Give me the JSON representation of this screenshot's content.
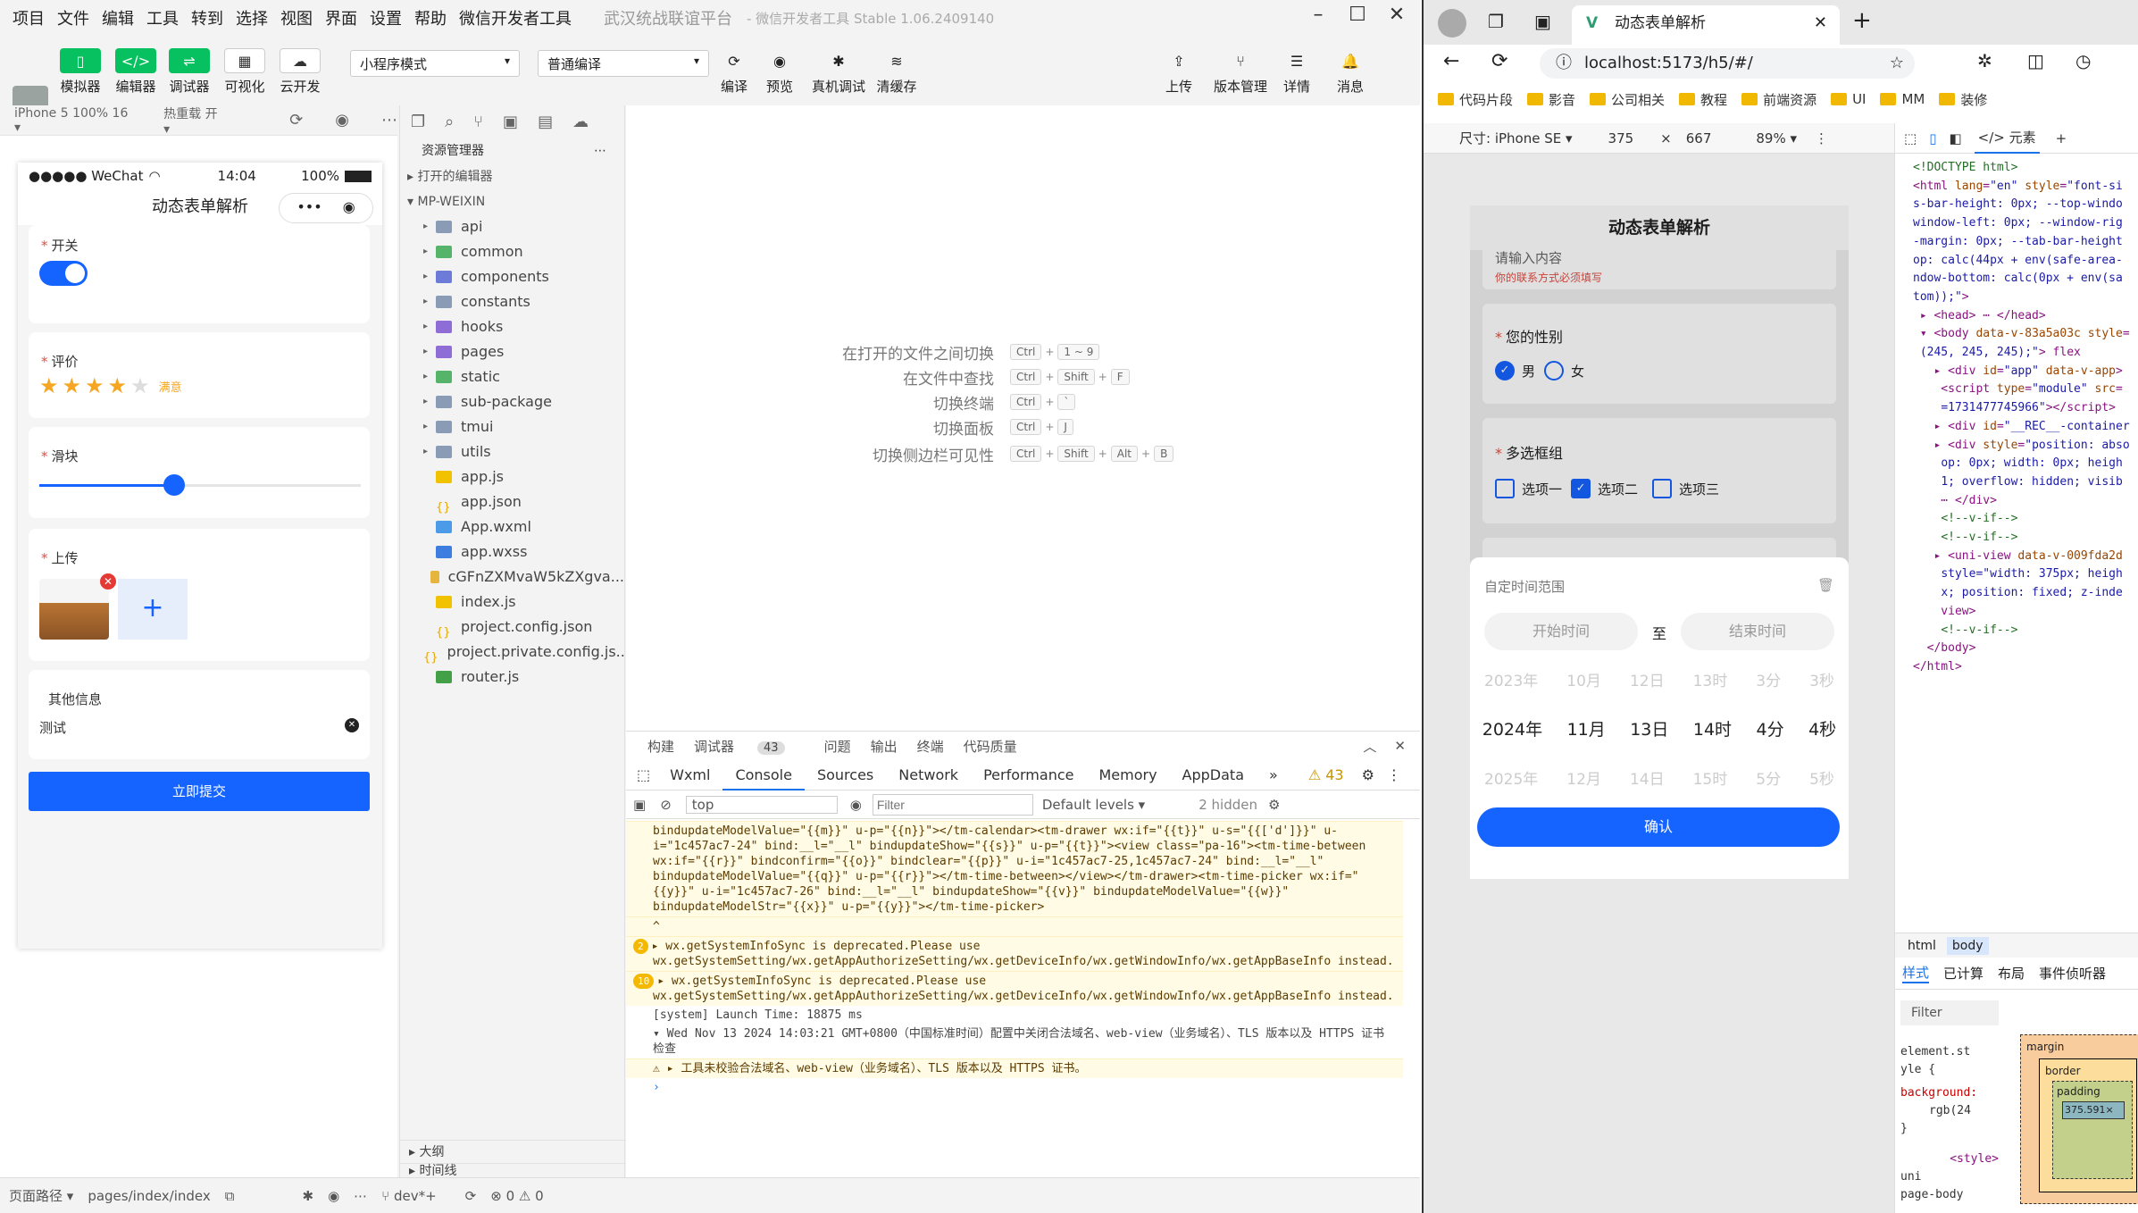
{
  "menubar": {
    "items": [
      "项目",
      "文件",
      "编辑",
      "工具",
      "转到",
      "选择",
      "视图",
      "界面",
      "设置",
      "帮助",
      "微信开发者工具"
    ],
    "app_title": "武汉统战联谊平台",
    "subtitle": "- 微信开发者工具 Stable 1.06.2409140"
  },
  "toolbar": {
    "simulator": "模拟器",
    "editor": "编辑器",
    "debugger": "调试器",
    "visual": "可视化",
    "cloud": "云开发",
    "mode_select": "小程序模式",
    "compile_select": "普通编译",
    "compile": "编译",
    "preview": "预览",
    "real_debug": "真机调试",
    "clear_cache": "清缓存",
    "upload": "上传",
    "version": "版本管理",
    "detail": "详情",
    "message": "消息"
  },
  "sim_toolbar": {
    "device": "iPhone 5 100% 16 ▾",
    "hotreload": "热重载 开 ▾"
  },
  "phone": {
    "carrier": "●●●●● WeChat",
    "time": "14:04",
    "battery": "100%",
    "title": "动态表单解析",
    "capsule_dots": "•••",
    "switch_label": "开关",
    "rating_label": "评价",
    "rating_text": "满意",
    "rating_value": 4,
    "rating_max": 5,
    "slider_label": "滑块",
    "slider_value": 0.42,
    "upload_label": "上传",
    "upload_plus": "+",
    "other_label": "其他信息",
    "other_value": "测试",
    "submit": "立即提交"
  },
  "explorer": {
    "title": "资源管理器",
    "open_editors": "打开的编辑器",
    "project": "MP-WEIXIN",
    "items": [
      {
        "name": "api",
        "type": "folder"
      },
      {
        "name": "common",
        "type": "folder"
      },
      {
        "name": "components",
        "type": "folder"
      },
      {
        "name": "constants",
        "type": "folder"
      },
      {
        "name": "hooks",
        "type": "folder"
      },
      {
        "name": "pages",
        "type": "folder"
      },
      {
        "name": "static",
        "type": "folder"
      },
      {
        "name": "sub-package",
        "type": "folder"
      },
      {
        "name": "tmui",
        "type": "folder"
      },
      {
        "name": "utils",
        "type": "folder"
      },
      {
        "name": "app.js",
        "type": "js"
      },
      {
        "name": "app.json",
        "type": "json"
      },
      {
        "name": "App.wxml",
        "type": "wxml"
      },
      {
        "name": "app.wxss",
        "type": "wxss"
      },
      {
        "name": "cGFnZXMvaW5kZXgva...",
        "type": "img"
      },
      {
        "name": "index.js",
        "type": "js"
      },
      {
        "name": "project.config.json",
        "type": "json"
      },
      {
        "name": "project.private.config.js...",
        "type": "json"
      },
      {
        "name": "router.js",
        "type": "router"
      }
    ],
    "outline": "大纲",
    "timeline": "时间线"
  },
  "shortcuts": [
    {
      "action": "在打开的文件之间切换",
      "keys": [
        "Ctrl",
        "1 ~ 9"
      ]
    },
    {
      "action": "在文件中查找",
      "keys": [
        "Ctrl",
        "Shift",
        "F"
      ]
    },
    {
      "action": "切换终端",
      "keys": [
        "Ctrl",
        "`"
      ]
    },
    {
      "action": "切换面板",
      "keys": [
        "Ctrl",
        "J"
      ]
    },
    {
      "action": "切换侧边栏可见性",
      "keys": [
        "Ctrl",
        "Shift",
        "Alt",
        "B"
      ]
    }
  ],
  "debug": {
    "tabs1": [
      "构建",
      "调试器",
      "问题",
      "输出",
      "终端",
      "代码质量"
    ],
    "badge": "43",
    "tabs2": [
      "Wxml",
      "Console",
      "Sources",
      "Network",
      "Performance",
      "Memory",
      "AppData"
    ],
    "more": "»",
    "warn_count": "43",
    "context": "top",
    "filter_placeholder": "Filter",
    "levels": "Default levels ▾",
    "hidden": "2 hidden",
    "console_lines": [
      "bindupdateModelValue=\"{{m}}\" u-p=\"{{n}}\"></tm-calendar><tm-drawer wx:if=\"{{t}}\" u-s=\"{{['d']}}\" u-i=\"1c457ac7-24\" bind:__l=\"__l\" bindupdateShow=\"{{s}}\" u-p=\"{{t}}\"><view class=\"pa-16\"><tm-time-between wx:if=\"{{r}}\" bindconfirm=\"{{o}}\" bindclear=\"{{p}}\" u-i=\"1c457ac7-25,1c457ac7-24\" bind:__l=\"__l\" bindupdateModelValue=\"{{q}}\" u-p=\"{{r}}\"></tm-time-between></view></tm-drawer><tm-time-picker wx:if=\"{{y}}\" u-i=\"1c457ac7-26\" bind:__l=\"__l\" bindupdateShow=\"{{v}}\" bindupdateModelValue=\"{{w}}\" bindupdateModelStr=\"{{x}}\" u-p=\"{{y}}\"></tm-time-picker>",
      "^",
      "wx.getSystemInfoSync is deprecated.Please use wx.getSystemSetting/wx.getAppAuthorizeSetting/wx.getDeviceInfo/wx.getWindowInfo/wx.getAppBaseInfo instead.",
      "wx.getSystemInfoSync is deprecated.Please use wx.getSystemSetting/wx.getAppAuthorizeSetting/wx.getDeviceInfo/wx.getWindowInfo/wx.getAppBaseInfo instead.",
      "[system] Launch Time: 18875 ms",
      "Wed Nov 13 2024 14:03:21 GMT+0800（中国标准时间）配置中关闭合法域名、web-view（业务域名）、TLS 版本以及 HTTPS 证书检查",
      "工具未校验合法域名、web-view（业务域名）、TLS 版本以及 HTTPS 证书。"
    ],
    "warn_badge_1": "2",
    "warn_badge_2": "10"
  },
  "statusbar": {
    "path_label": "页面路径 ▾",
    "path": "pages/index/index",
    "branch": "dev*+",
    "errors": "⊗ 0 ⚠ 0"
  },
  "browser": {
    "tab_title": "动态表单解析",
    "url": "localhost:5173/h5/#/",
    "bookmarks": [
      "代码片段",
      "影音",
      "公司相关",
      "教程",
      "前端资源",
      "UI",
      "MM",
      "装修"
    ],
    "device": "尺寸: iPhone SE ▾",
    "width": "375",
    "times": "×",
    "height": "667",
    "zoom": "89% ▾"
  },
  "h5": {
    "title": "动态表单解析",
    "input_placeholder": "请输入内容",
    "input_error": "你的联系方式必须填写",
    "gender_label": "您的性别",
    "male": "男",
    "female": "女",
    "checkbox_label": "多选框组",
    "options": [
      "选项一",
      "选项二",
      "选项三"
    ],
    "sheet_title": "自定时间范围",
    "start": "开始时间",
    "to": "至",
    "end": "结束时间",
    "prev_row": [
      "2023年",
      "10月",
      "12日",
      "13时",
      "3分",
      "3秒"
    ],
    "sel_row": [
      "2024年",
      "11月",
      "13日",
      "14时",
      "4分",
      "4秒"
    ],
    "next_row": [
      "2025年",
      "12月",
      "14日",
      "15时",
      "5分",
      "5秒"
    ],
    "confirm": "确认"
  },
  "devtools": {
    "elements_tab": "</> 元素",
    "crumbs": [
      "html",
      "body"
    ],
    "tabs": [
      "样式",
      "已计算",
      "布局",
      "事件侦听器"
    ],
    "filter": "Filter",
    "style_lines": [
      "element.st",
      "yle {",
      "background:",
      "rgb(24",
      "}"
    ],
    "style_tag": "<style>",
    "uni_line": "uni",
    "page_body": "page-body",
    "box_margin": "margin",
    "box_border": "border",
    "box_padding": "padding",
    "box_content": "375.591×",
    "box_dash": "-"
  }
}
